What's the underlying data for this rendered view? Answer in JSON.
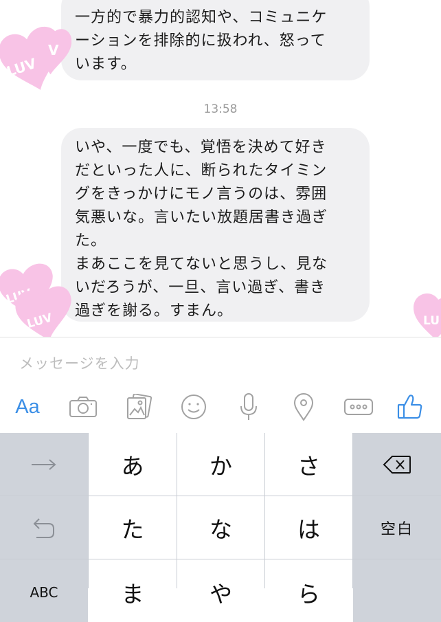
{
  "messages": [
    {
      "text": "一方的で暴力的認知や、コミュニケ\nーションを排除的に扱われ、怒って\nいます。"
    },
    {
      "text": "いや、一度でも、覚悟を決めて好き\nだといった人に、断られたタイミン\nグをきっかけにモノ言うのは、雰囲\n気悪いな。言いたい放題居書き過ぎ\nた。\nまあここを見てないと思うし、見な\nいだろうが、一旦、言い過ぎ、書き\n過ぎを謝る。すまん。"
    }
  ],
  "timestamp": "13:58",
  "stickers": [
    "LUV",
    "V",
    "LUV",
    "LUV",
    "LU"
  ],
  "input": {
    "placeholder": "メッセージを入力"
  },
  "toolbar": {
    "text_label": "Aa"
  },
  "keyboard": {
    "row1": [
      "あ",
      "か",
      "さ"
    ],
    "row2": [
      "た",
      "な",
      "は"
    ],
    "row3": [
      "ま",
      "や",
      "ら"
    ],
    "space_label": "空白",
    "abc_label": "ABC"
  },
  "colors": {
    "accent": "#3a8ee6",
    "bubble": "#f0f0f2",
    "sticker": "#f8c3e6"
  }
}
